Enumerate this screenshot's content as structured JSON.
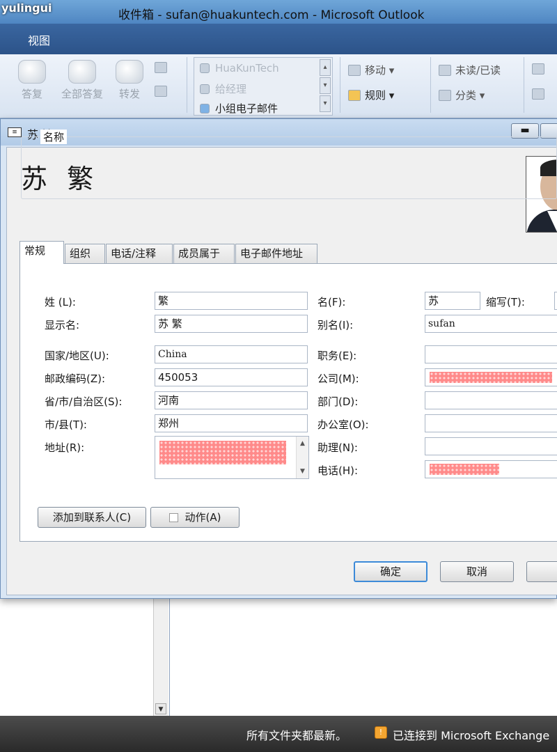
{
  "watermark": "yulingui",
  "window": {
    "title": "收件箱 - sufan@huakuntech.com - Microsoft Outlook"
  },
  "menu": {
    "view": "视图"
  },
  "ribbon": {
    "reply": "答复",
    "reply_all": "全部答复",
    "forward": "转发",
    "quick_steps": [
      "HuaKunTech",
      "给经理",
      "小组电子邮件"
    ],
    "move": "移动",
    "rules": "规则",
    "unread_read": "未读/已读",
    "categorize": "分类"
  },
  "dialog": {
    "title": "苏 繁",
    "heading": "苏 繁",
    "tabs": [
      "常规",
      "组织",
      "电话/注释",
      "成员属于",
      "电子邮件地址"
    ],
    "active_tab": "常规",
    "name_group": "名称",
    "fields": {
      "last_name_label": "姓 (L):",
      "last_name": "繁",
      "first_name_label": "名(F):",
      "first_name": "苏",
      "initials_label": "缩写(T):",
      "display_name_label": "显示名:",
      "display_name": "苏 繁",
      "alias_label": "别名(I):",
      "alias": "sufan",
      "country_label": "国家/地区(U):",
      "country": "China",
      "title_label": "职务(E):",
      "title": "",
      "postal_label": "邮政编码(Z):",
      "postal": "450053",
      "company_label": "公司(M):",
      "province_label": "省/市/自治区(S):",
      "province": "河南",
      "department_label": "部门(D):",
      "department": "",
      "city_label": "市/县(T):",
      "city": "郑州",
      "office_label": "办公室(O):",
      "office": "",
      "address_label": "地址(R):",
      "assistant_label": "助理(N):",
      "assistant": "",
      "phone_label": "电话(H):"
    },
    "buttons": {
      "add_contact": "添加到联系人(C)",
      "actions": "动作(A)",
      "ok": "确定",
      "cancel": "取消"
    }
  },
  "status": {
    "left": "所有文件夹都最新。",
    "right": "已连接到 Microsoft Exchange"
  }
}
